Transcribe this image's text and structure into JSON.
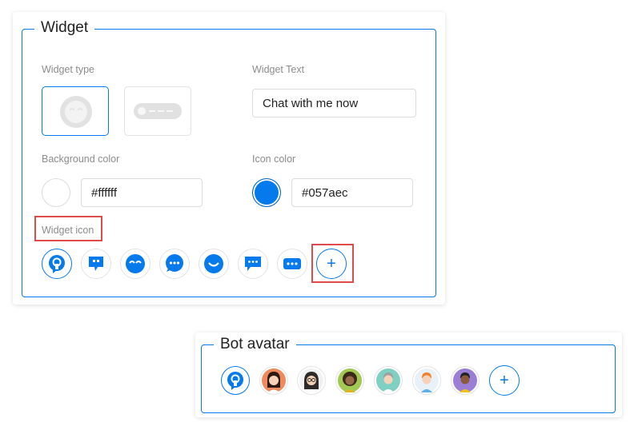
{
  "widget": {
    "legend": "Widget",
    "type_label": "Widget type",
    "text_label": "Widget Text",
    "text_value": "Chat with me now",
    "bg_label": "Background color",
    "bg_value": "#ffffff",
    "icon_color_label": "Icon color",
    "icon_color_value": "#057aec",
    "icon_label": "Widget icon",
    "icons": [
      "speech-bubble-icon",
      "chat-square-icon",
      "smile-face-icon",
      "dots-bubble-icon",
      "smile-icon",
      "message-square-icon",
      "dots-rect-icon"
    ],
    "add_label": "+"
  },
  "bot": {
    "legend": "Bot avatar",
    "avatars": [
      "bot-bubble-avatar",
      "woman-avatar",
      "woman-glasses-avatar",
      "woman-curly-avatar",
      "man-gray-avatar",
      "man-orange-avatar",
      "man-dark-avatar"
    ],
    "add_label": "+"
  },
  "colors": {
    "accent": "#057aec",
    "highlight": "#e04a4a"
  }
}
